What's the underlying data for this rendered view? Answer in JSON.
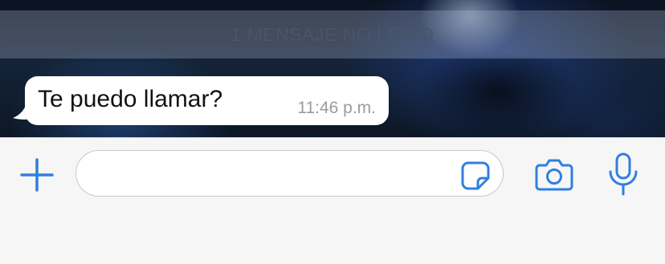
{
  "chat": {
    "unread_banner": "1 MENSAJE NO LEÍDO",
    "message": {
      "text": "Te puedo llamar?",
      "time": "11:46 p.m."
    }
  },
  "input_bar": {
    "placeholder": "",
    "icons": {
      "add": "plus-icon",
      "sticker": "sticker-icon",
      "camera": "camera-icon",
      "microphone": "microphone-icon"
    },
    "accent_color": "#2f7fe0"
  }
}
